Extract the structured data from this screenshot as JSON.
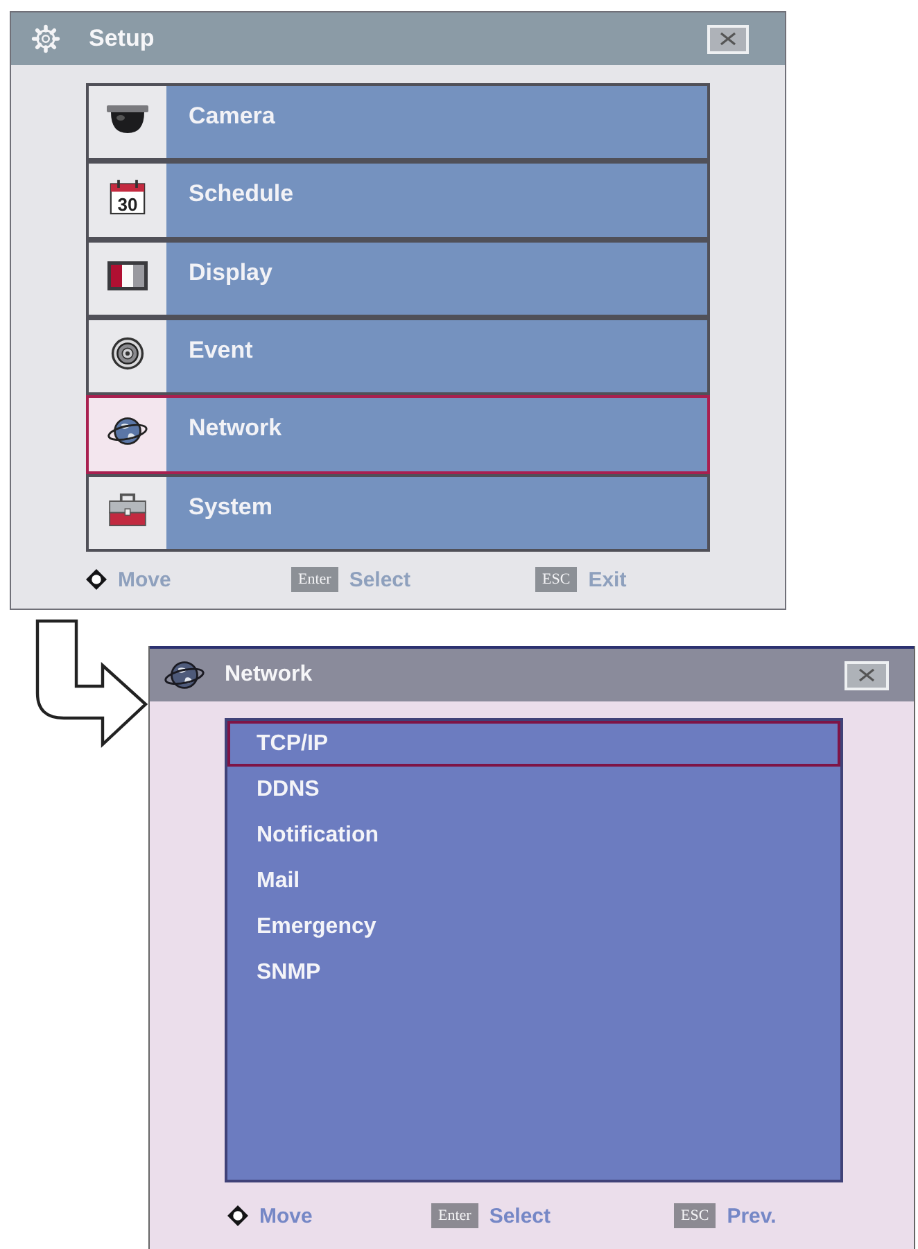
{
  "setup_window": {
    "title": "Setup",
    "menu": [
      {
        "label": "Camera",
        "kind": "camera",
        "selected": false
      },
      {
        "label": "Schedule",
        "kind": "calendar",
        "icon_text": "30",
        "selected": false
      },
      {
        "label": "Display",
        "kind": "display",
        "selected": false
      },
      {
        "label": "Event",
        "kind": "event",
        "selected": false
      },
      {
        "label": "Network",
        "kind": "network",
        "selected": true
      },
      {
        "label": "System",
        "kind": "system",
        "selected": false
      }
    ],
    "hints": [
      {
        "kind": "dpad",
        "label": "Move"
      },
      {
        "kind": "key",
        "key": "Enter",
        "label": "Select"
      },
      {
        "kind": "key",
        "key": "ESC",
        "label": "Exit"
      }
    ]
  },
  "network_window": {
    "title": "Network",
    "items": [
      {
        "label": "TCP/IP",
        "selected": true
      },
      {
        "label": "DDNS",
        "selected": false
      },
      {
        "label": "Notification",
        "selected": false
      },
      {
        "label": "Mail",
        "selected": false
      },
      {
        "label": "Emergency",
        "selected": false
      },
      {
        "label": "SNMP",
        "selected": false
      }
    ],
    "hints": [
      {
        "kind": "dpad",
        "label": "Move"
      },
      {
        "kind": "key",
        "key": "Enter",
        "label": "Select"
      },
      {
        "kind": "key",
        "key": "ESC",
        "label": "Prev."
      }
    ]
  }
}
